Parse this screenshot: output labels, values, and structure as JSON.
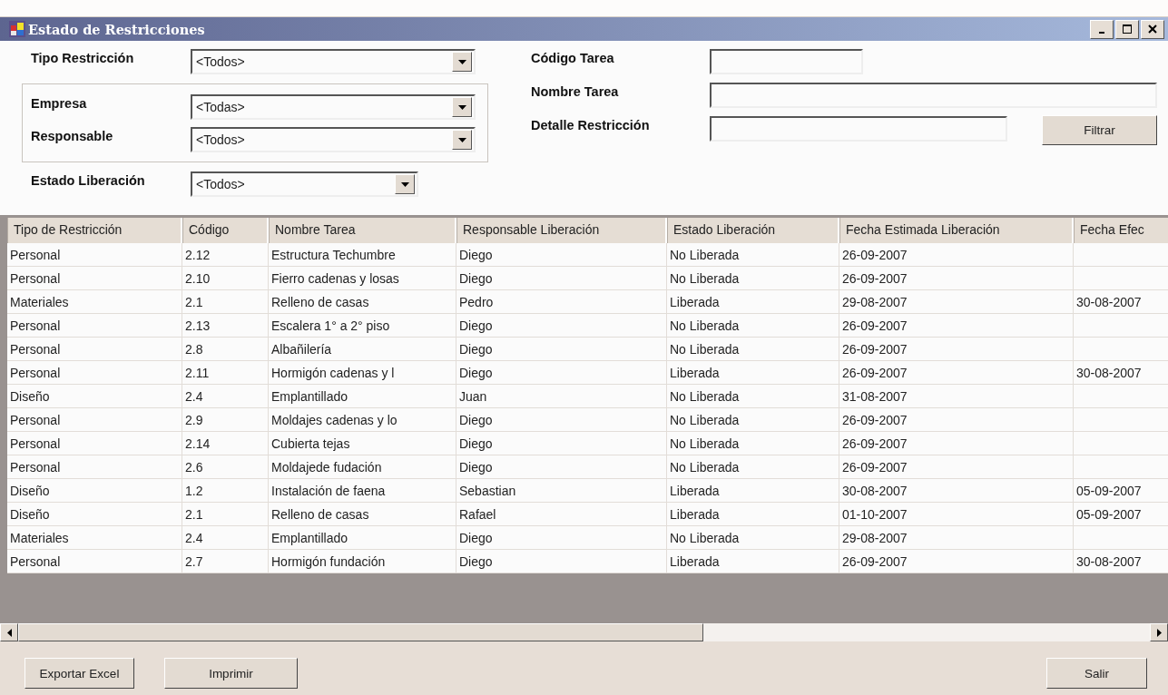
{
  "window": {
    "title": "Estado de Restricciones"
  },
  "tipo_restriccion": {
    "label": "Tipo Restricción",
    "value": "<Todos>"
  },
  "group": [
    {
      "label": "Empresa",
      "value": "<Todas>"
    },
    {
      "label": "Responsable",
      "value": "<Todos>"
    }
  ],
  "estado_liberacion": {
    "label": "Estado Liberación",
    "value": "<Todos>"
  },
  "text_fields": [
    {
      "label": "Código Tarea"
    },
    {
      "label": "Nombre Tarea"
    },
    {
      "label": "Detalle Restricción"
    }
  ],
  "filter_button": "Filtrar",
  "table": {
    "columns": [
      "Tipo de Restricción",
      "Código",
      "Nombre Tarea",
      "Responsable Liberación",
      "Estado Liberación",
      "Fecha Estimada Liberación",
      "Fecha Efec"
    ],
    "rows": [
      [
        "Personal",
        "2.12",
        "Estructura Techumbre",
        "Diego",
        "No Liberada",
        "26-09-2007",
        ""
      ],
      [
        "Personal",
        "2.10",
        "Fierro cadenas y losas",
        "Diego",
        "No Liberada",
        "26-09-2007",
        ""
      ],
      [
        "Materiales",
        "2.1",
        "Relleno de casas",
        "Pedro",
        "Liberada",
        "29-08-2007",
        "30-08-2007"
      ],
      [
        "Personal",
        "2.13",
        "Escalera 1° a 2° piso",
        "Diego",
        "No Liberada",
        "26-09-2007",
        ""
      ],
      [
        "Personal",
        "2.8",
        "Albañilería",
        "Diego",
        "No Liberada",
        "26-09-2007",
        ""
      ],
      [
        "Personal",
        "2.11",
        "Hormigón cadenas y l",
        "Diego",
        "Liberada",
        "26-09-2007",
        "30-08-2007"
      ],
      [
        "Diseño",
        "2.4",
        "Emplantillado",
        "Juan",
        "No Liberada",
        "31-08-2007",
        ""
      ],
      [
        "Personal",
        "2.9",
        "Moldajes cadenas y lo",
        "Diego",
        "No Liberada",
        "26-09-2007",
        ""
      ],
      [
        "Personal",
        "2.14",
        "Cubierta tejas",
        "Diego",
        "No Liberada",
        "26-09-2007",
        ""
      ],
      [
        "Personal",
        "2.6",
        "Moldajede fudación",
        "Diego",
        "No Liberada",
        "26-09-2007",
        ""
      ],
      [
        "Diseño",
        "1.2",
        "Instalación de faena",
        "Sebastian",
        "Liberada",
        "30-08-2007",
        "05-09-2007"
      ],
      [
        "Diseño",
        "2.1",
        "Relleno de casas",
        "Rafael",
        "Liberada",
        "01-10-2007",
        "05-09-2007"
      ],
      [
        "Materiales",
        "2.4",
        "Emplantillado",
        "Diego",
        "No Liberada",
        "29-08-2007",
        ""
      ],
      [
        "Personal",
        "2.7",
        "Hormigón fundación",
        "Diego",
        "Liberada",
        "26-09-2007",
        "30-08-2007"
      ]
    ]
  },
  "left_buttons": [
    "Exportar Excel",
    "Imprimir"
  ],
  "right_button": "Salir"
}
